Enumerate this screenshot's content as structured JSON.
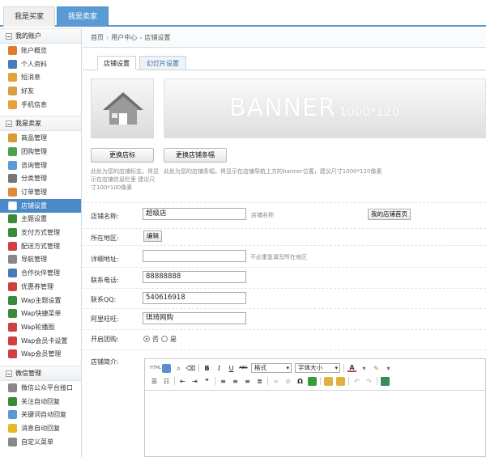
{
  "top_tabs": {
    "buyer": "我是买家",
    "seller": "我是卖家"
  },
  "sidebar": {
    "sections": [
      {
        "title": "我的账户",
        "items": [
          {
            "label": "账户概览",
            "icon": "home-icon",
            "color": "#e07b2a"
          },
          {
            "label": "个人资料",
            "icon": "id-card-icon",
            "color": "#4a7bb7"
          },
          {
            "label": "短消息",
            "icon": "envelope-icon",
            "color": "#e5a23a"
          },
          {
            "label": "好友",
            "icon": "user-icon",
            "color": "#d4a040"
          },
          {
            "label": "手机信息",
            "icon": "envelope-icon",
            "color": "#e5a23a"
          }
        ]
      },
      {
        "title": "我是卖家",
        "items": [
          {
            "label": "商品管理",
            "icon": "box-icon",
            "color": "#d99b3a"
          },
          {
            "label": "团购管理",
            "icon": "group-icon",
            "color": "#4aa34a"
          },
          {
            "label": "咨询管理",
            "icon": "chat-icon",
            "color": "#5b9bd5"
          },
          {
            "label": "分类管理",
            "icon": "list-icon",
            "color": "#777777"
          },
          {
            "label": "订单管理",
            "icon": "edit-icon",
            "color": "#e08a3a"
          },
          {
            "label": "店铺设置",
            "icon": "home-icon",
            "color": "#ffffff",
            "active": true
          },
          {
            "label": "主题设置",
            "icon": "theme-icon",
            "color": "#3a8a3a"
          },
          {
            "label": "支付方式管理",
            "icon": "payment-icon",
            "color": "#3a8a3a"
          },
          {
            "label": "配送方式管理",
            "icon": "truck-icon",
            "color": "#d04040"
          },
          {
            "label": "导航管理",
            "icon": "nav-icon",
            "color": "#888888"
          },
          {
            "label": "合作伙伴管理",
            "icon": "partner-icon",
            "color": "#4a7bb7"
          },
          {
            "label": "优惠券管理",
            "icon": "coupon-icon",
            "color": "#d04040"
          },
          {
            "label": "Wap主题设置",
            "icon": "theme-icon",
            "color": "#3a8a3a"
          },
          {
            "label": "Wap快捷菜单",
            "icon": "menu-icon",
            "color": "#3a8a3a"
          },
          {
            "label": "Wap轮播图",
            "icon": "image-icon",
            "color": "#d04040"
          },
          {
            "label": "Wap会员卡设置",
            "icon": "card-icon",
            "color": "#d04040"
          },
          {
            "label": "Wap会员管理",
            "icon": "member-icon",
            "color": "#d04040"
          }
        ]
      },
      {
        "title": "微信管理",
        "items": [
          {
            "label": "微信公众平台接口",
            "icon": "doc-icon",
            "color": "#888888"
          },
          {
            "label": "关注自动回复",
            "icon": "reply-icon",
            "color": "#3a8a3a"
          },
          {
            "label": "关键词自动回复",
            "icon": "chat-icon",
            "color": "#5b9bd5"
          },
          {
            "label": "消息自动回复",
            "icon": "star-icon",
            "color": "#e5b82a"
          },
          {
            "label": "自定义菜单",
            "icon": "menu-icon",
            "color": "#888888"
          }
        ]
      }
    ]
  },
  "breadcrumb": {
    "home": "首页",
    "sep": "›",
    "user_center": "用户中心",
    "current": "店铺设置"
  },
  "sub_tabs": {
    "store_settings": "店铺设置",
    "slideshow": "幻灯片设置"
  },
  "banner": {
    "text": "BANNER",
    "size": "1000*120"
  },
  "buttons": {
    "change_logo": "更换店标",
    "change_banner": "更换店铺条幅",
    "my_store_home": "我的店铺首页",
    "edit": "编辑"
  },
  "hints": {
    "logo": "此处为您的店铺标志，将显示在店铺信息栏里 建议尺寸100*100像素",
    "banner": "此处为您的店铺条幅，将显示在店铺导航上方的banner位置，建议尺寸1000*120像素"
  },
  "form": {
    "store_name": {
      "label": "店铺名称:",
      "value": "超级店",
      "note": "店铺名称"
    },
    "region": {
      "label": "所在地区:"
    },
    "address": {
      "label": "详细地址:",
      "value": "",
      "note": "不必重复填写所在地区"
    },
    "phone": {
      "label": "联系电话:",
      "value": "88888888"
    },
    "qq": {
      "label": "联系QQ:",
      "value": "540616918"
    },
    "wangwang": {
      "label": "阿里旺旺:",
      "value": "琪琦网购"
    },
    "group_buy": {
      "label": "开启团购:",
      "no": "否",
      "yes": "是",
      "selected": "否"
    },
    "intro": {
      "label": "店铺简介:"
    }
  },
  "editor": {
    "format_select": "格式",
    "font_size_select": "字体大小"
  },
  "colors": {
    "accent": "#4a8ac6",
    "tab_blue": "#5b9bd5"
  }
}
